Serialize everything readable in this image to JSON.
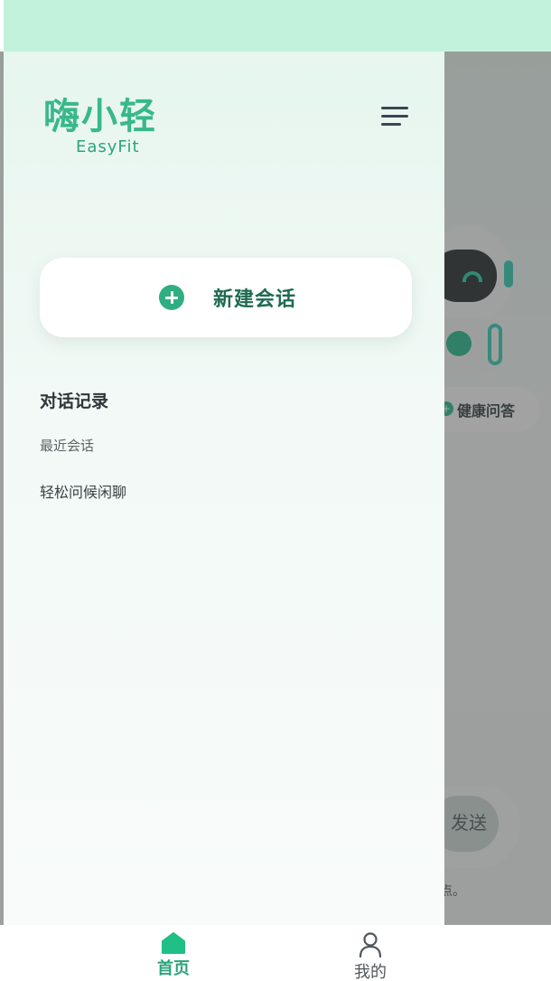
{
  "app": {
    "logo_cn": "嗨小轻",
    "logo_en": "EasyFit"
  },
  "drawer": {
    "new_chat_label": "新建会话",
    "section_title": "对话记录",
    "history_group_label": "最近会话",
    "history_items": [
      "轻松问候闲聊"
    ]
  },
  "background": {
    "chip_label": "健康问答",
    "send_label": "发送",
    "disclaimer_tail": "点。"
  },
  "bottom_nav": {
    "items": [
      {
        "label": "首页",
        "icon": "home-icon",
        "active": true
      },
      {
        "label": "我的",
        "icon": "user-icon",
        "active": false
      }
    ]
  },
  "colors": {
    "brand_green": "#39b889",
    "status_strip": "#c3f2dc",
    "active_nav": "#2aa47a"
  }
}
